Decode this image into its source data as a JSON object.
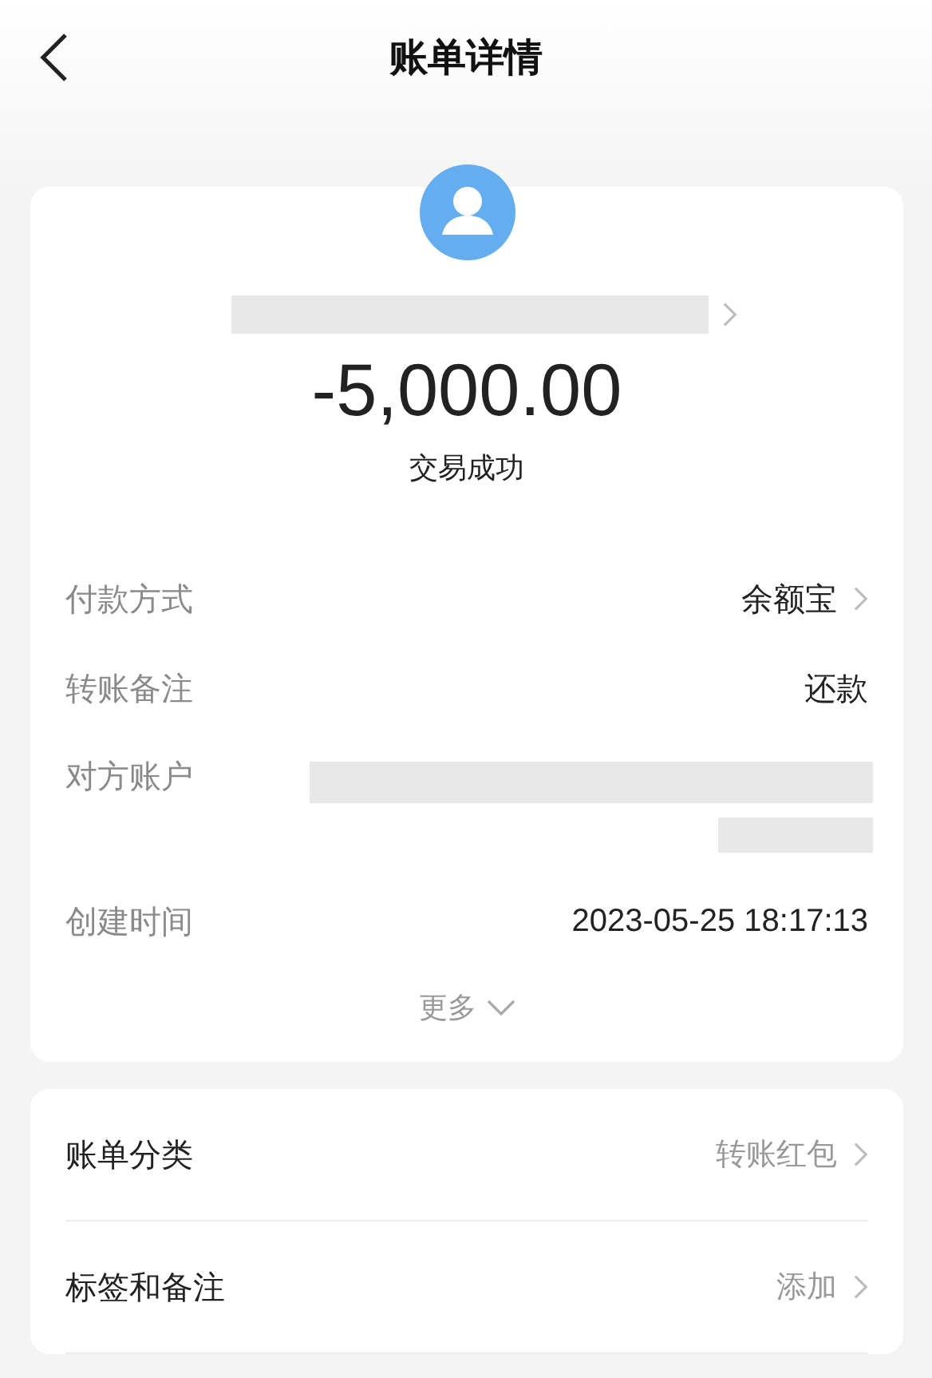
{
  "header": {
    "title": "账单详情"
  },
  "summary": {
    "name_hidden": true,
    "amount": "-5,000.00",
    "status": "交易成功"
  },
  "details": [
    {
      "kind": "link",
      "label": "付款方式",
      "value": "余额宝"
    },
    {
      "kind": "text",
      "label": "转账备注",
      "value": "还款"
    },
    {
      "kind": "hidden",
      "label": "对方账户"
    },
    {
      "kind": "text",
      "label": "创建时间",
      "value": "2023-05-25 18:17:13"
    }
  ],
  "more": {
    "label": "更多",
    "expanded": false
  },
  "options": [
    {
      "label": "账单分类",
      "value": "转账红包"
    },
    {
      "label": "标签和备注",
      "value": "添加"
    }
  ]
}
